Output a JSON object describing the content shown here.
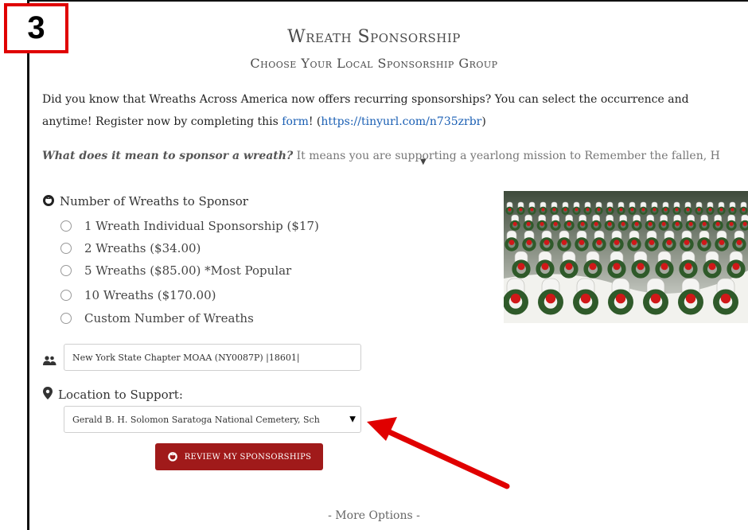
{
  "step_number": "3",
  "header": {
    "title": "Wreath Sponsorship",
    "subtitle": "Choose Your Local Sponsorship Group"
  },
  "intro": {
    "line1": "Did you know that Wreaths Across America now offers recurring sponsorships? You can select the occurrence and",
    "line2_prefix": "anytime! Register now by completing this ",
    "form_link": "form",
    "line2_mid": "! (",
    "url_link": "https://tinyurl.com/n735zrbr",
    "line2_suffix": ")"
  },
  "question": {
    "bold": "What does it mean to sponsor a wreath?",
    "rest": " It means you are supporting a yearlong mission to Remember the fallen, H"
  },
  "wreaths": {
    "label": "Number of Wreaths to Sponsor",
    "options": [
      "1 Wreath Individual Sponsorship ($17)",
      "2 Wreaths ($34.00)",
      "5 Wreaths ($85.00) *Most Popular",
      "10 Wreaths ($170.00)",
      "Custom Number of Wreaths"
    ]
  },
  "group": {
    "value": "New York State Chapter MOAA (NY0087P) |18601|"
  },
  "location": {
    "label": "Location to Support:",
    "selected": "Gerald B. H. Solomon Saratoga National Cemetery, Sch"
  },
  "review_button": "REVIEW MY SPONSORSHIPS",
  "more_options": "- More Options -",
  "colors": {
    "accent_red": "#a01a1a",
    "annotation_red": "#e00000",
    "link_blue": "#1a5fb4"
  },
  "icons": {
    "wreath": "wreath-icon",
    "group": "people-icon",
    "location": "map-pin-icon",
    "select": "caret-down-icon"
  }
}
